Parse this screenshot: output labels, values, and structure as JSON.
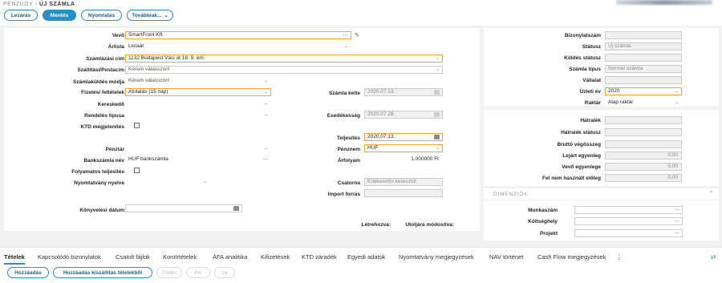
{
  "breadcrumb": {
    "section": "PÉNZÜGY",
    "sep": "›",
    "title": "ÚJ SZÁMLA"
  },
  "toolbar": {
    "close": "Lezárás",
    "save": "Mentés",
    "print": "Nyomtatás",
    "more": "Továbbiak..."
  },
  "form": {
    "buyer": {
      "label": "Vevő",
      "value": "SmartFront Kft."
    },
    "pricelist": {
      "label": "Árlista",
      "value": "Listaár"
    },
    "billing_address": {
      "label": "Számlázási cím",
      "value": "1132 Budapest Váci út 18. 9. em."
    },
    "shipping_address": {
      "label": "Szállítási/Postacím",
      "value": "Kérem válasszon!"
    },
    "send_method": {
      "label": "Számlaküldés módja",
      "value": "Kérem válasszon!"
    },
    "payment_terms": {
      "label": "Fizetési feltételek",
      "value": "Átutalás (15 nap)"
    },
    "dealer": {
      "label": "Kereskedő",
      "value": ""
    },
    "order_type": {
      "label": "Rendelés típusa",
      "value": ""
    },
    "ktd": {
      "label": "KTD megjelenítés"
    },
    "cashdesk": {
      "label": "Pénztár",
      "value": ""
    },
    "bank_account": {
      "label": "Bankszámla név",
      "value": "HUF bankszámla"
    },
    "continuous": {
      "label": "Folyamatos teljesítés"
    },
    "print_language": {
      "label": "Nyomtatvány nyelve",
      "value": ""
    },
    "booking_date": {
      "label": "Könyvelési dátum",
      "value": ""
    }
  },
  "dates": {
    "invoice_date": {
      "label": "Számla kelte",
      "value": "2020.07.13."
    },
    "due_date": {
      "label": "Esedékesség",
      "value": "2020.07.28."
    },
    "fulfillment": {
      "label": "Teljesítés",
      "value": "2020.07.13."
    },
    "currency": {
      "label": "Pénznem",
      "value": "HUF"
    },
    "rate": {
      "label": "Árfolyam",
      "value": "1.000000 Ft"
    },
    "channel": {
      "label": "Csatorna",
      "value": "Értékesítőn keresztül"
    },
    "import": {
      "label": "Import forrás",
      "value": ""
    },
    "created_by": {
      "label": "Létrehozva:"
    },
    "modified_by": {
      "label": "Utoljára módosítva:"
    }
  },
  "info": {
    "doc_number": {
      "label": "Bizonylatszám",
      "value": ""
    },
    "status": {
      "label": "Státusz",
      "value": "Új számla"
    },
    "send_status": {
      "label": "Küldés státusz",
      "value": ""
    },
    "invoice_type": {
      "label": "Számla típus",
      "value": "Normál számla"
    },
    "company": {
      "label": "Vállalat",
      "value": ""
    },
    "business_year": {
      "label": "Üzleti év",
      "value": "2020"
    },
    "warehouse": {
      "label": "Raktár",
      "value": "Alap raktár"
    }
  },
  "arrears": {
    "arrears": {
      "label": "Hátralék",
      "value": ""
    },
    "arrears_status": {
      "label": "Hátralék státusz",
      "value": ""
    },
    "gross_total": {
      "label": "Bruttó végösszeg",
      "value": ""
    },
    "expired_balance": {
      "label": "Lejárt egyenleg",
      "value": "0.00"
    },
    "buyer_balance": {
      "label": "Vevő egyenlege",
      "value": "0.00"
    },
    "unused_advance": {
      "label": "Fel nem használt előleg",
      "value": "0.00"
    }
  },
  "dimensions": {
    "title": "DIMENZIÓK",
    "worknumber": {
      "label": "Munkaszám",
      "value": ""
    },
    "costcenter": {
      "label": "Költséghely",
      "value": ""
    },
    "project": {
      "label": "Projekt",
      "value": ""
    }
  },
  "tabs": [
    "Tételek",
    "Kapcsolódó bizonylatok",
    "Csatolt fájlok",
    "Kontírtételek",
    "ÁFA analitika",
    "Kifizetések",
    "KTD záradék",
    "Egyedi adatok",
    "Nyomtatvány megjegyzések",
    "NAV történet",
    "Cash Flow megjegyzések"
  ],
  "items_toolbar": {
    "add": "Hozzáadás",
    "add_from": "Hozzáadás kiszállítás tételekből",
    "delete": "Törlés",
    "up": "Fel",
    "down": "Le"
  }
}
